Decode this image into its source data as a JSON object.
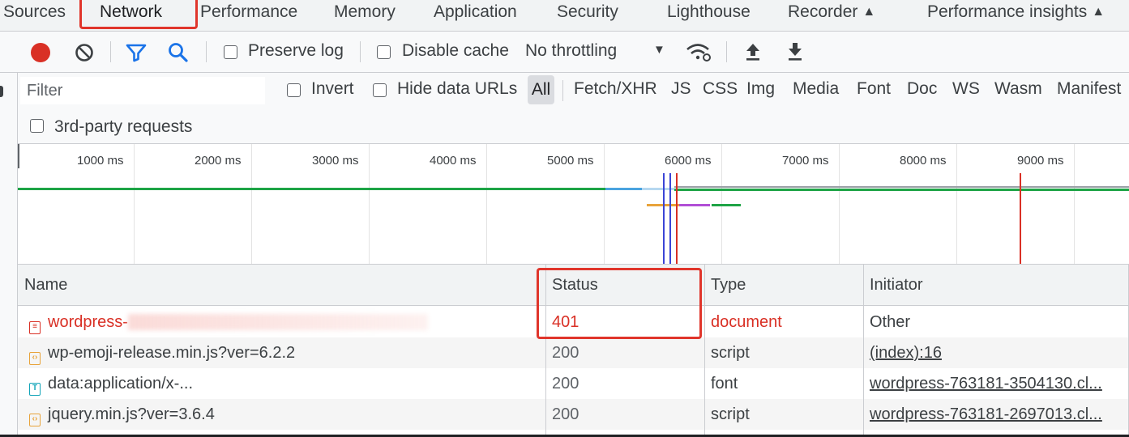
{
  "tabs": [
    {
      "label": "Sources"
    },
    {
      "label": "Network",
      "active": true
    },
    {
      "label": "Performance"
    },
    {
      "label": "Memory"
    },
    {
      "label": "Application"
    },
    {
      "label": "Security"
    },
    {
      "label": "Lighthouse"
    },
    {
      "label": "Recorder",
      "experimental": true
    },
    {
      "label": "Performance insights",
      "experimental": true
    }
  ],
  "toolbar": {
    "record_icon": "record-icon",
    "clear_icon": "clear-icon",
    "filter_icon": "filter-icon",
    "search_icon": "search-icon",
    "preserve_log": "Preserve log",
    "disable_cache": "Disable cache",
    "throttling": "No throttling",
    "network_conditions_icon": "wifi-settings-icon",
    "import_icon": "upload-icon",
    "export_icon": "download-icon"
  },
  "filterbar": {
    "placeholder": "Filter",
    "invert": "Invert",
    "hide_data_urls": "Hide data URLs",
    "types": [
      "All",
      "Fetch/XHR",
      "JS",
      "CSS",
      "Img",
      "Media",
      "Font",
      "Doc",
      "WS",
      "Wasm",
      "Manifest"
    ],
    "third_party": "3rd-party requests"
  },
  "timeline": {
    "ticks": [
      "1000 ms",
      "2000 ms",
      "3000 ms",
      "4000 ms",
      "5000 ms",
      "6000 ms",
      "7000 ms",
      "8000 ms",
      "9000 ms"
    ]
  },
  "table": {
    "headers": {
      "name": "Name",
      "status": "Status",
      "type": "Type",
      "initiator": "Initiator"
    },
    "rows": [
      {
        "name": "wordpress-",
        "status": "401",
        "type": "document",
        "initiator": "Other",
        "icon": "document-icon",
        "error": true
      },
      {
        "name": "wp-emoji-release.min.js?ver=6.2.2",
        "status": "200",
        "type": "script",
        "initiator": "(index):16",
        "icon": "script-icon"
      },
      {
        "name": "data:application/x-...",
        "status": "200",
        "type": "font",
        "initiator": "wordpress-763181-3504130.cl...",
        "icon": "font-icon"
      },
      {
        "name": "jquery.min.js?ver=3.6.4",
        "status": "200",
        "type": "script",
        "initiator": "wordpress-763181-2697013.cl...",
        "icon": "script-icon"
      }
    ]
  },
  "colors": {
    "accent_blue": "#1a73e8",
    "record_red": "#d93025",
    "error_red": "#d93025",
    "highlight_red": "#e0352b",
    "timeline_green": "#1ea446"
  }
}
